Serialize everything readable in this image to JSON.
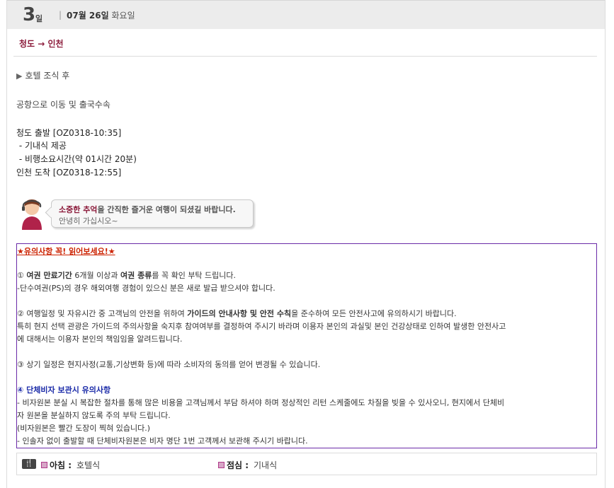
{
  "day": {
    "number": "3",
    "unit": "일",
    "separator": "|",
    "date": "07월 26일",
    "weekday": "화요일"
  },
  "route": "청도 → 인천",
  "steps": {
    "hotel": "호텔 조식 후",
    "airport": "공항으로 이동 및 출국수속"
  },
  "flight": {
    "depart": "청도 출발 [OZ0318-10:35]",
    "meal": " - 기내식 제공",
    "duration": " - 비행소요시간(약 01시간 20분)",
    "arrive": "인천 도착 [OZ0318-12:55]"
  },
  "guide": {
    "highlight": "소중한 추억",
    "line1_rest": "을 간직한 즐거운 여행이 되셨길 바랍니다.",
    "line2": "안녕히 가십시오~"
  },
  "notice": {
    "title": "★유의사항 꼭! 읽어보세요!★",
    "p1_num": "①",
    "p1_b1": "여권 만료기간",
    "p1_m1": " 6개월 이상과 ",
    "p1_b2": "여권 종류",
    "p1_m2": "를 꼭 확인 부탁 드립니다.",
    "p1_l2": "-단수여권(PS)의 경우 해외여행 경험이 있으신 분은 새로 발급 받으셔야 합니다.",
    "p2_a": "② 여행일정 및 자유시간 중 고객님의 안전을 위하여 ",
    "p2_b": "가이드의 안내사항 및 안전 수칙",
    "p2_c": "을 준수하여 모든 안전사고에 유의하시기 바랍니다.",
    "p2_l2": "특히 현지 선택 관광은 가이드의 주의사항을 숙지후 참여여부를 결정하여 주시기 바라며 이용자 본인의 과실및 본인 건강상태로 인하여 발생한 안전사고",
    "p2_l3": "에 대해서는 이용자 본인의 책임임을 알려드립니다.",
    "p3": "③ 상기 일정은 현지사정(교통,기상변화 등)에 따라 소비자의 동의를 얻어 변경될 수 있습니다.",
    "p4_title": "④ 단체비자 보관시 유의사항",
    "p4_l1": "- 비자원본 분실 시 복잡한 절차를 통해 많은 비용을 고객님께서 부담 하셔야 하며 정상적인 리턴 스케줄에도 차질을 빚을 수 있사오니, 현지에서 단체비",
    "p4_l2": "자 원본을 분실하지 않도록 주의 부탁 드립니다.",
    "p4_l3": "(비자원본은 빨간 도장이 찍혀 있습니다.)",
    "p4_l4": "- 인솔자 없이 출발할 때 단체비자원본은 비자 명단 1번 고객께서 보관해 주시기 바랍니다."
  },
  "meals": {
    "breakfast_label": "아침",
    "breakfast_value": "호텔식",
    "lunch_label": "점심",
    "lunch_value": "기내식"
  },
  "colors": {
    "route": "#8b1a3a",
    "notice_border": "#6a2aa8",
    "warn": "#cc2200",
    "blue": "#1a2aa8"
  }
}
